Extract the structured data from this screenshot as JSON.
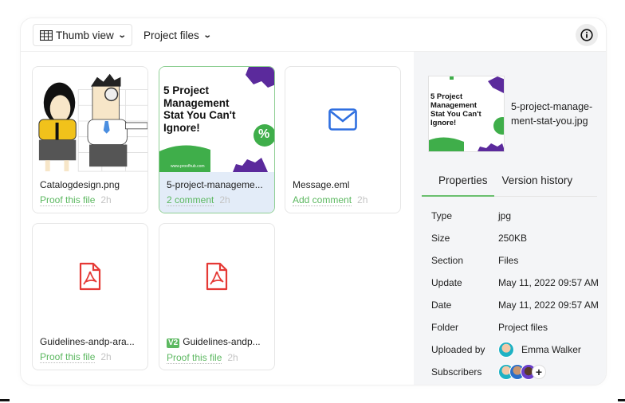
{
  "toolbar": {
    "view_label": "Thumb view",
    "view_icon": "grid-table-icon",
    "folder_label": "Project files",
    "info_icon": "info-icon"
  },
  "files": [
    {
      "name": "Catalogdesign.png",
      "action": "Proof this file",
      "time": "2h",
      "thumb": "illustration",
      "selected": false
    },
    {
      "name": "5-project-manageme...",
      "action": "2 comment",
      "time": "2h",
      "thumb": "promo",
      "selected": true
    },
    {
      "name": "Message.eml",
      "action": "Add comment",
      "time": "2h",
      "thumb": "mail-icon",
      "selected": false
    },
    {
      "name": "Guidelines-andp-ara...",
      "action": "Proof this file",
      "time": "2h",
      "thumb": "pdf-icon",
      "selected": false
    },
    {
      "name": "Guidelines-andp...",
      "version": "V2",
      "action": "Proof this file",
      "time": "2h",
      "thumb": "pdf-icon",
      "selected": false
    }
  ],
  "promo": {
    "headline_lines": [
      "5 Project",
      "Management",
      "Stat You Can't",
      "Ignore!"
    ],
    "footer_url": "www.proofhub.com",
    "percent_symbol": "%"
  },
  "panel": {
    "file_name_lines": [
      "5-project-manage-",
      "ment-stat-you.jpg"
    ],
    "tabs": [
      {
        "label": "Properties",
        "active": true
      },
      {
        "label": "Version history",
        "active": false
      }
    ],
    "properties": [
      {
        "key": "Type",
        "value": "jpg"
      },
      {
        "key": "Size",
        "value": "250KB"
      },
      {
        "key": "Section",
        "value": "Files"
      },
      {
        "key": "Update",
        "value": "May 11, 2022 09:57 AM"
      },
      {
        "key": "Date",
        "value": "May 11, 2022 09:57 AM"
      },
      {
        "key": "Folder",
        "value": "Project files"
      },
      {
        "key": "Uploaded by",
        "value": "Emma Walker"
      },
      {
        "key": "Subscribers",
        "value": ""
      }
    ],
    "subscribers_count_shown": 3,
    "add_subscriber_label": "+"
  },
  "colors": {
    "accent_green": "#5cb860",
    "selected_bg": "#e3ecf8",
    "panel_bg": "#f4f5f7",
    "pdf_red": "#e53935",
    "mail_blue": "#2f6fe0",
    "promo_purple": "#5b2a9c"
  }
}
